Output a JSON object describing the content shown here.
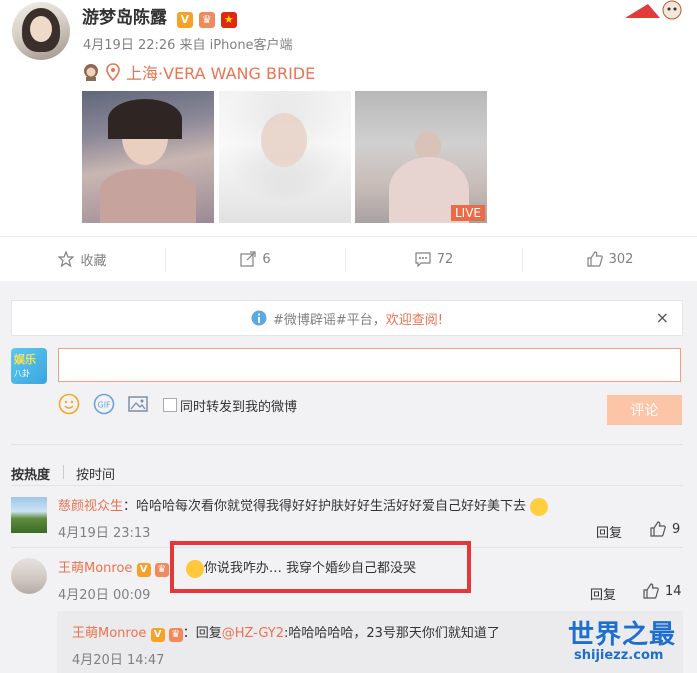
{
  "post": {
    "author": "游梦岛陈露",
    "verified_badge": "V",
    "time": "4月19日 22:26 来自 iPhone客户端",
    "location": "上海·VERA WANG BRIDE",
    "live_tag": "LIVE"
  },
  "actions": {
    "favorite": "收藏",
    "repost": "6",
    "comment": "72",
    "like": "302"
  },
  "notice": {
    "prefix": "#微博辟谣#平台，",
    "highlight": "欢迎查阅!",
    "close": "×"
  },
  "composer": {
    "my_avatar_text": "娱乐",
    "my_avatar_sub": "八卦",
    "gif_label": "GIF",
    "repost_checkbox_label": "同时转发到我的微博",
    "submit_label": "评论"
  },
  "sort": {
    "by_hot": "按热度",
    "by_time": "按时间"
  },
  "comments": [
    {
      "author": "慈颜视众生",
      "text": "：哈哈哈每次看你就觉得我得好好护肤好好生活好好爱自己好好美下去",
      "time": "4月19日 23:13",
      "reply_label": "回复",
      "likes": "9"
    },
    {
      "author": "王萌Monroe",
      "text": "你说我咋办… 我穿个婚纱自己都没哭",
      "time": "4月20日 00:09",
      "reply_label": "回复",
      "likes": "14"
    }
  ],
  "sub_reply": {
    "author": "王萌Monroe",
    "prefix": "：回复",
    "mention": "@HZ-GY2",
    "text": ":哈哈哈哈哈，23号那天你们就知道了",
    "time": "4月20日 14:47"
  },
  "watermark": {
    "title": "世界之最",
    "url": "shijiezz.com"
  },
  "colors": {
    "accent": "#eb7350",
    "highlight_box": "#e23838",
    "watermark": "#1c6fd1"
  }
}
